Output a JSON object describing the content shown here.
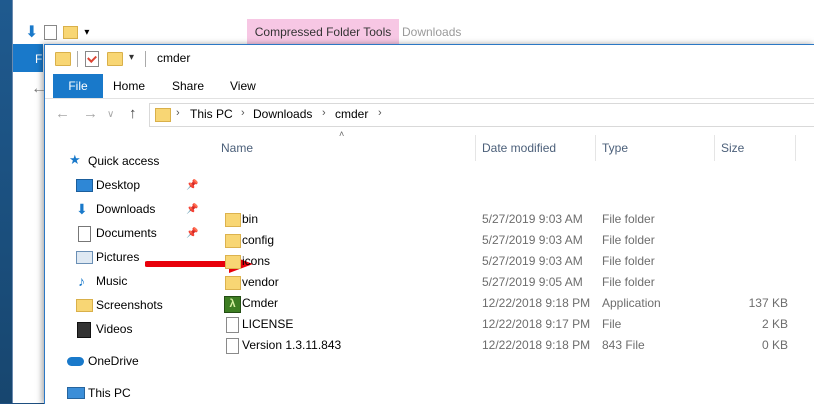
{
  "back_window": {
    "context_tab": "Compressed Folder Tools",
    "location": "Downloads",
    "ribbon_file": "F"
  },
  "window": {
    "title": "cmder",
    "ribbon_tabs": [
      "File",
      "Home",
      "Share",
      "View"
    ],
    "breadcrumb": [
      "This PC",
      "Downloads",
      "cmder"
    ]
  },
  "nav_pane": {
    "quick_access": "Quick access",
    "items": [
      {
        "label": "Desktop",
        "icon": "desktop-icon",
        "pinned": true
      },
      {
        "label": "Downloads",
        "icon": "download-arrow-icon",
        "pinned": true
      },
      {
        "label": "Documents",
        "icon": "documents-icon",
        "pinned": true
      },
      {
        "label": "Pictures",
        "icon": "pictures-icon",
        "pinned": false
      },
      {
        "label": "Music",
        "icon": "music-icon",
        "pinned": false
      },
      {
        "label": "Screenshots",
        "icon": "folder-icon",
        "pinned": false
      },
      {
        "label": "Videos",
        "icon": "videos-icon",
        "pinned": false
      }
    ],
    "onedrive": "OneDrive",
    "this_pc": "This PC"
  },
  "columns": {
    "name": "Name",
    "date_modified": "Date modified",
    "type": "Type",
    "size": "Size"
  },
  "files": [
    {
      "name": "bin",
      "date": "5/27/2019 9:03 AM",
      "type": "File folder",
      "size": "",
      "icon": "folder"
    },
    {
      "name": "config",
      "date": "5/27/2019 9:03 AM",
      "type": "File folder",
      "size": "",
      "icon": "folder"
    },
    {
      "name": "icons",
      "date": "5/27/2019 9:03 AM",
      "type": "File folder",
      "size": "",
      "icon": "folder"
    },
    {
      "name": "vendor",
      "date": "5/27/2019 9:05 AM",
      "type": "File folder",
      "size": "",
      "icon": "folder"
    },
    {
      "name": "Cmder",
      "date": "12/22/2018 9:18 PM",
      "type": "Application",
      "size": "137 KB",
      "icon": "app"
    },
    {
      "name": "LICENSE",
      "date": "12/22/2018 9:17 PM",
      "type": "File",
      "size": "2 KB",
      "icon": "file"
    },
    {
      "name": "Version 1.3.11.843",
      "date": "12/22/2018 9:18 PM",
      "type": "843 File",
      "size": "0 KB",
      "icon": "file"
    }
  ],
  "colors": {
    "accent": "#1979ca",
    "context_tab": "#f7c7e4",
    "annotation_arrow": "#e8000b",
    "folder": "#f8d674"
  }
}
